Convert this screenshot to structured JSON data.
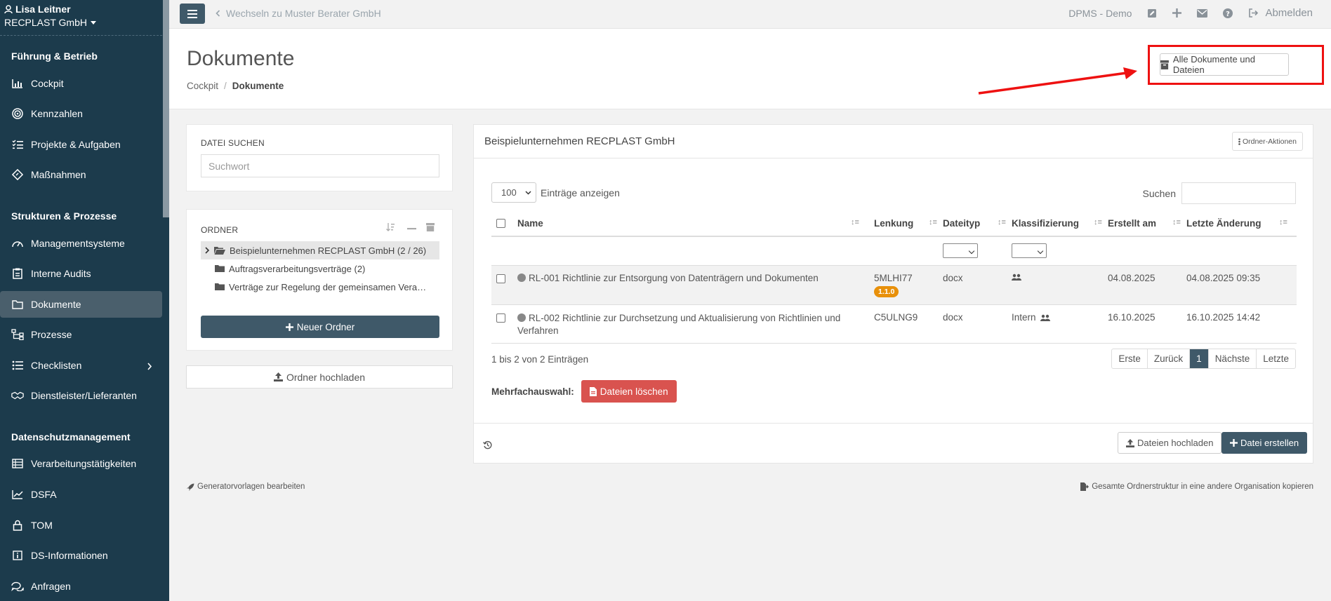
{
  "sidebar": {
    "user_name": "Lisa Leitner",
    "org_name": "RECPLAST GmbH",
    "sections": [
      {
        "title": "Führung & Betrieb"
      },
      {
        "title": "Strukturen & Prozesse"
      },
      {
        "title": "Datenschutzmanagement"
      }
    ],
    "items": [
      {
        "label": "Cockpit",
        "icon": "chart-icon"
      },
      {
        "label": "Kennzahlen",
        "icon": "target-icon"
      },
      {
        "label": "Projekte & Aufgaben",
        "icon": "tasks-icon"
      },
      {
        "label": "Maßnahmen",
        "icon": "diamond-icon"
      },
      {
        "label": "Managementsysteme",
        "icon": "gauge-icon"
      },
      {
        "label": "Interne Audits",
        "icon": "clipboard-icon"
      },
      {
        "label": "Dokumente",
        "icon": "folder-icon"
      },
      {
        "label": "Prozesse",
        "icon": "sitemap-icon"
      },
      {
        "label": "Checklisten",
        "icon": "list-icon"
      },
      {
        "label": "Dienstleister/Lieferanten",
        "icon": "handshake-icon"
      },
      {
        "label": "Verarbeitungstätigkeiten",
        "icon": "table-icon"
      },
      {
        "label": "DSFA",
        "icon": "line-chart-icon"
      },
      {
        "label": "TOM",
        "icon": "lock-icon"
      },
      {
        "label": "DS-Informationen",
        "icon": "info-icon"
      },
      {
        "label": "Anfragen",
        "icon": "comments-icon"
      }
    ]
  },
  "topbar": {
    "switch_label": "Wechseln zu Muster Berater GmbH",
    "env_label": "DPMS - Demo",
    "logout_label": "Abmelden"
  },
  "header": {
    "title": "Dokumente",
    "breadcrumb_root": "Cockpit",
    "breadcrumb_current": "Dokumente",
    "all_docs_label": "Alle Dokumente und Dateien"
  },
  "search_panel": {
    "label": "DATEI SUCHEN",
    "placeholder": "Suchwort"
  },
  "folder_panel": {
    "label": "ORDNER",
    "folders": [
      "Beispielunternehmen RECPLAST GmbH (2 / 26)",
      "Auftragsverarbeitungsverträge (2)",
      "Verträge zur Regelung der gemeinsamen Vera…"
    ],
    "new_folder_label": "Neuer Ordner",
    "upload_folder_label": "Ordner hochladen"
  },
  "main": {
    "title": "Beispielunternehmen RECPLAST GmbH",
    "folder_actions_label": "Ordner-Aktionen",
    "page_size": "100",
    "entries_label": "Einträge anzeigen",
    "search_label": "Suchen",
    "columns": [
      "Name",
      "Lenkung",
      "Dateityp",
      "Klassifizierung",
      "Erstellt am",
      "Letzte Änderung"
    ],
    "rows": [
      {
        "name": "RL-001 Richtlinie zur Entsorgung von Datenträgern und Dokumenten",
        "lenkung": "5MLHI77",
        "version": "1.1.0",
        "dateityp": "docx",
        "klassifizierung": "",
        "erstellt": "04.08.2025",
        "geaendert": "04.08.2025 09:35"
      },
      {
        "name_line1": "RL-002 Richtlinie zur Durchsetzung und Aktualisierung von Richtlinien und",
        "name_line2": "Verfahren",
        "lenkung": "C5ULNG9",
        "dateityp": "docx",
        "klassifizierung": "Intern",
        "erstellt": "16.10.2025",
        "geaendert": "16.10.2025 14:42"
      }
    ],
    "info": "1 bis 2 von 2 Einträgen",
    "pager": [
      "Erste",
      "Zurück",
      "1",
      "Nächste",
      "Letzte"
    ],
    "multi_label": "Mehrfachauswahl:",
    "delete_label": "Dateien löschen",
    "upload_files_label": "Dateien hochladen",
    "create_file_label": "Datei erstellen"
  },
  "footer": {
    "generator_label": "Generatorvorlagen bearbeiten",
    "copy_label": "Gesamte Ordnerstruktur in eine andere Organisation kopieren"
  },
  "colors": {
    "sidebar_bg": "#1c3b4c",
    "primary": "#3f5969",
    "danger": "#d9534f",
    "badge": "#e8900a",
    "annotation": "#e11111"
  }
}
